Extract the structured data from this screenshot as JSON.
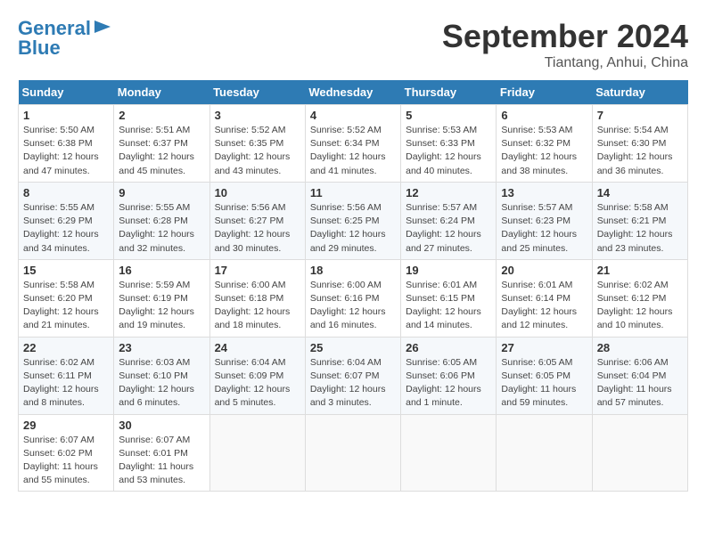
{
  "header": {
    "logo_line1": "General",
    "logo_line2": "Blue",
    "month": "September 2024",
    "location": "Tiantang, Anhui, China"
  },
  "days_of_week": [
    "Sunday",
    "Monday",
    "Tuesday",
    "Wednesday",
    "Thursday",
    "Friday",
    "Saturday"
  ],
  "weeks": [
    [
      {
        "day": "1",
        "info": "Sunrise: 5:50 AM\nSunset: 6:38 PM\nDaylight: 12 hours\nand 47 minutes."
      },
      {
        "day": "2",
        "info": "Sunrise: 5:51 AM\nSunset: 6:37 PM\nDaylight: 12 hours\nand 45 minutes."
      },
      {
        "day": "3",
        "info": "Sunrise: 5:52 AM\nSunset: 6:35 PM\nDaylight: 12 hours\nand 43 minutes."
      },
      {
        "day": "4",
        "info": "Sunrise: 5:52 AM\nSunset: 6:34 PM\nDaylight: 12 hours\nand 41 minutes."
      },
      {
        "day": "5",
        "info": "Sunrise: 5:53 AM\nSunset: 6:33 PM\nDaylight: 12 hours\nand 40 minutes."
      },
      {
        "day": "6",
        "info": "Sunrise: 5:53 AM\nSunset: 6:32 PM\nDaylight: 12 hours\nand 38 minutes."
      },
      {
        "day": "7",
        "info": "Sunrise: 5:54 AM\nSunset: 6:30 PM\nDaylight: 12 hours\nand 36 minutes."
      }
    ],
    [
      {
        "day": "8",
        "info": "Sunrise: 5:55 AM\nSunset: 6:29 PM\nDaylight: 12 hours\nand 34 minutes."
      },
      {
        "day": "9",
        "info": "Sunrise: 5:55 AM\nSunset: 6:28 PM\nDaylight: 12 hours\nand 32 minutes."
      },
      {
        "day": "10",
        "info": "Sunrise: 5:56 AM\nSunset: 6:27 PM\nDaylight: 12 hours\nand 30 minutes."
      },
      {
        "day": "11",
        "info": "Sunrise: 5:56 AM\nSunset: 6:25 PM\nDaylight: 12 hours\nand 29 minutes."
      },
      {
        "day": "12",
        "info": "Sunrise: 5:57 AM\nSunset: 6:24 PM\nDaylight: 12 hours\nand 27 minutes."
      },
      {
        "day": "13",
        "info": "Sunrise: 5:57 AM\nSunset: 6:23 PM\nDaylight: 12 hours\nand 25 minutes."
      },
      {
        "day": "14",
        "info": "Sunrise: 5:58 AM\nSunset: 6:21 PM\nDaylight: 12 hours\nand 23 minutes."
      }
    ],
    [
      {
        "day": "15",
        "info": "Sunrise: 5:58 AM\nSunset: 6:20 PM\nDaylight: 12 hours\nand 21 minutes."
      },
      {
        "day": "16",
        "info": "Sunrise: 5:59 AM\nSunset: 6:19 PM\nDaylight: 12 hours\nand 19 minutes."
      },
      {
        "day": "17",
        "info": "Sunrise: 6:00 AM\nSunset: 6:18 PM\nDaylight: 12 hours\nand 18 minutes."
      },
      {
        "day": "18",
        "info": "Sunrise: 6:00 AM\nSunset: 6:16 PM\nDaylight: 12 hours\nand 16 minutes."
      },
      {
        "day": "19",
        "info": "Sunrise: 6:01 AM\nSunset: 6:15 PM\nDaylight: 12 hours\nand 14 minutes."
      },
      {
        "day": "20",
        "info": "Sunrise: 6:01 AM\nSunset: 6:14 PM\nDaylight: 12 hours\nand 12 minutes."
      },
      {
        "day": "21",
        "info": "Sunrise: 6:02 AM\nSunset: 6:12 PM\nDaylight: 12 hours\nand 10 minutes."
      }
    ],
    [
      {
        "day": "22",
        "info": "Sunrise: 6:02 AM\nSunset: 6:11 PM\nDaylight: 12 hours\nand 8 minutes."
      },
      {
        "day": "23",
        "info": "Sunrise: 6:03 AM\nSunset: 6:10 PM\nDaylight: 12 hours\nand 6 minutes."
      },
      {
        "day": "24",
        "info": "Sunrise: 6:04 AM\nSunset: 6:09 PM\nDaylight: 12 hours\nand 5 minutes."
      },
      {
        "day": "25",
        "info": "Sunrise: 6:04 AM\nSunset: 6:07 PM\nDaylight: 12 hours\nand 3 minutes."
      },
      {
        "day": "26",
        "info": "Sunrise: 6:05 AM\nSunset: 6:06 PM\nDaylight: 12 hours\nand 1 minute."
      },
      {
        "day": "27",
        "info": "Sunrise: 6:05 AM\nSunset: 6:05 PM\nDaylight: 11 hours\nand 59 minutes."
      },
      {
        "day": "28",
        "info": "Sunrise: 6:06 AM\nSunset: 6:04 PM\nDaylight: 11 hours\nand 57 minutes."
      }
    ],
    [
      {
        "day": "29",
        "info": "Sunrise: 6:07 AM\nSunset: 6:02 PM\nDaylight: 11 hours\nand 55 minutes."
      },
      {
        "day": "30",
        "info": "Sunrise: 6:07 AM\nSunset: 6:01 PM\nDaylight: 11 hours\nand 53 minutes."
      },
      null,
      null,
      null,
      null,
      null
    ]
  ]
}
